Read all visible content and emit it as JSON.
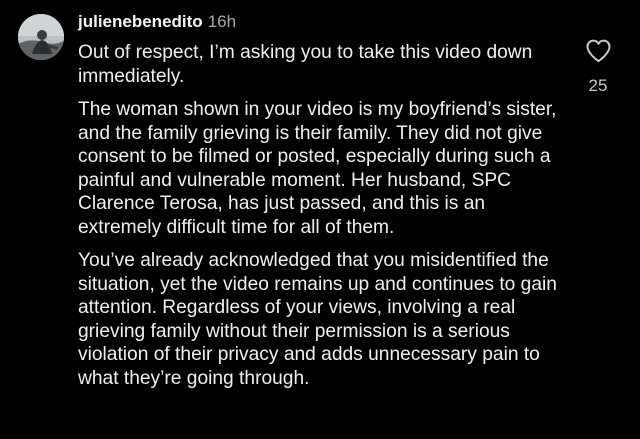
{
  "comment": {
    "username": "julienebenedito",
    "time": "16h",
    "paragraphs": [
      "Out of respect, I’m asking you to take this video down immediately.",
      "The woman shown in your video is my boyfriend’s sister, and the family grieving is their family. They did not give consent to be filmed or posted, especially during such a painful and vulnerable moment. Her husband, SPC Clarence Terosa, has just passed, and this is an extremely difficult time for all of them.",
      "You’ve already acknowledged that you misidentified the situation, yet the video remains up and continues to gain attention. Regardless of your views, involving a real grieving family without their permission is a serious violation of their privacy and adds unnecessary pain to what they’re going through."
    ],
    "like_icon": "heart-outline-icon",
    "like_count": "25"
  },
  "colors": {
    "background": "#000000",
    "text": "#f0f0f0",
    "secondary_text": "#a8a8a8"
  }
}
